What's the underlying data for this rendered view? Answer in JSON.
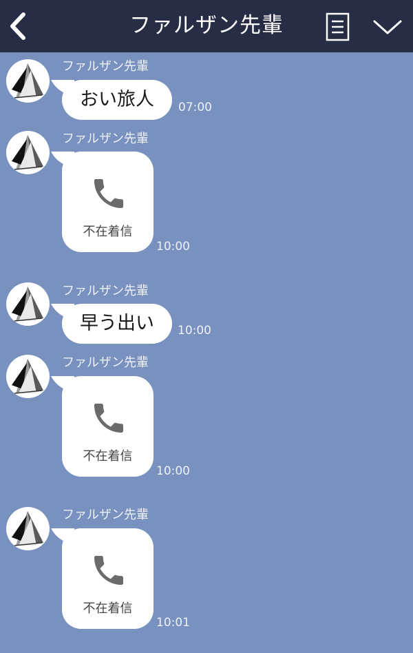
{
  "header": {
    "title": "ファルザン先輩",
    "back_icon": "chevron-left-icon",
    "notes_icon": "notes-icon",
    "menu_icon": "chevron-down-icon",
    "background": "#262d45"
  },
  "chat": {
    "background": "#7891bf",
    "messages": [
      {
        "sender": "ファルザン先輩",
        "type": "text",
        "text": "おい旅人",
        "time": "07:00"
      },
      {
        "sender": "ファルザン先輩",
        "type": "missed-call",
        "label": "不在着信",
        "time": "10:00"
      },
      {
        "sender": "ファルザン先輩",
        "type": "text",
        "text": "早う出い",
        "time": "10:00"
      },
      {
        "sender": "ファルザン先輩",
        "type": "missed-call",
        "label": "不在着信",
        "time": "10:00"
      },
      {
        "sender": "ファルザン先輩",
        "type": "missed-call",
        "label": "不在着信",
        "time": "10:01"
      }
    ]
  }
}
